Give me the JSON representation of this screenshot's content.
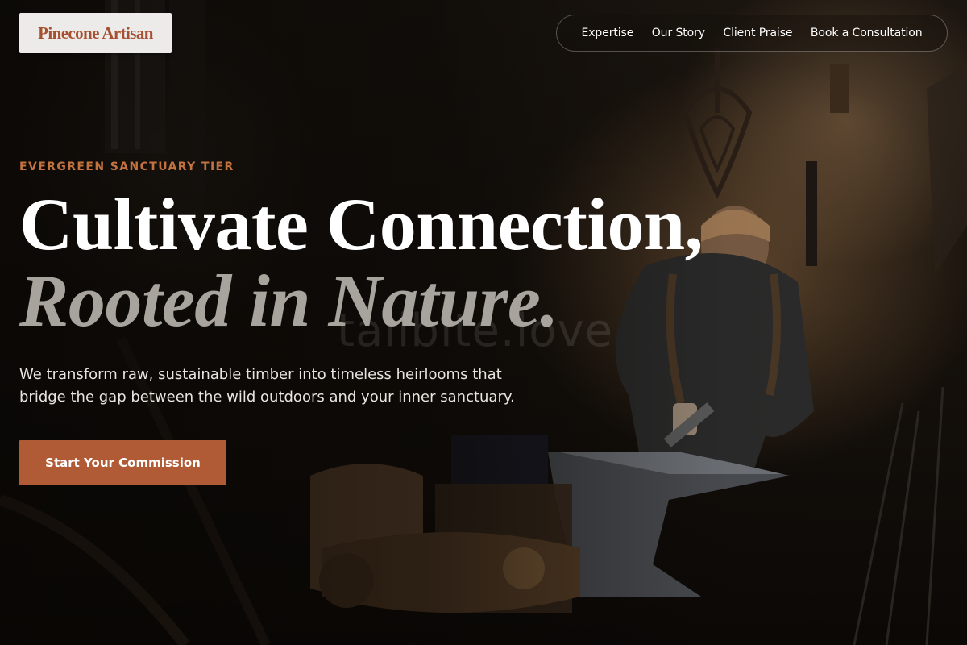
{
  "brand": {
    "logo_text": "Pinecone Artisan"
  },
  "nav": {
    "items": [
      {
        "label": "Expertise"
      },
      {
        "label": "Our Story"
      },
      {
        "label": "Client Praise"
      },
      {
        "label": "Book a Consultation"
      }
    ]
  },
  "hero": {
    "eyebrow": "EVERGREEN SANCTUARY TIER",
    "headline_line1": "Cultivate Connection,",
    "headline_line2": "Rooted in Nature.",
    "watermark": "tailbite.love",
    "description": "We transform raw, sustainable timber into timeless heirlooms that bridge the gap between the wild outdoors and your inner sanctuary.",
    "cta_label": "Start Your Commission"
  },
  "colors": {
    "accent": "#b05a36",
    "eyebrow": "#c4733f",
    "logo_text": "#a7502f",
    "headline_muted": "#a8a39d"
  }
}
